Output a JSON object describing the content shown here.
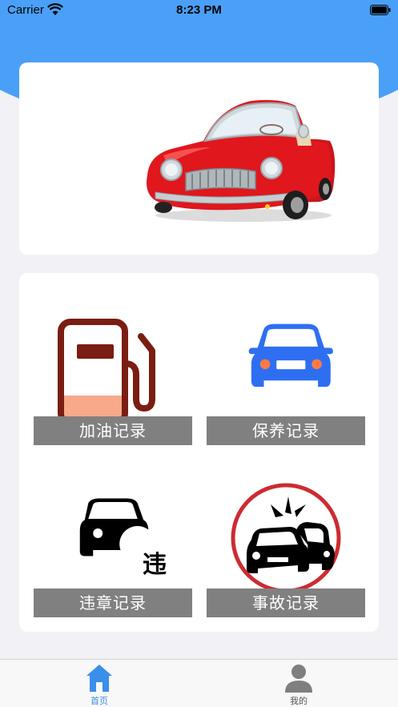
{
  "status_bar": {
    "carrier": "Carrier",
    "time": "8:23 PM"
  },
  "banner": {
    "image": "red-convertible-car-illustration"
  },
  "grid": {
    "items": [
      {
        "label": "加油记录",
        "icon": "fuel-pump-icon"
      },
      {
        "label": "保养记录",
        "icon": "car-front-icon"
      },
      {
        "label": "违章记录",
        "icon": "violation-car-icon",
        "badge": "违"
      },
      {
        "label": "事故记录",
        "icon": "car-accident-icon"
      }
    ]
  },
  "tab_bar": {
    "items": [
      {
        "label": "首页",
        "icon": "home-icon",
        "active": true
      },
      {
        "label": "我的",
        "icon": "user-icon",
        "active": false
      }
    ]
  },
  "colors": {
    "header_blue": "#4aa0f7",
    "tab_active": "#3b8eea",
    "label_bg": "#808080"
  }
}
